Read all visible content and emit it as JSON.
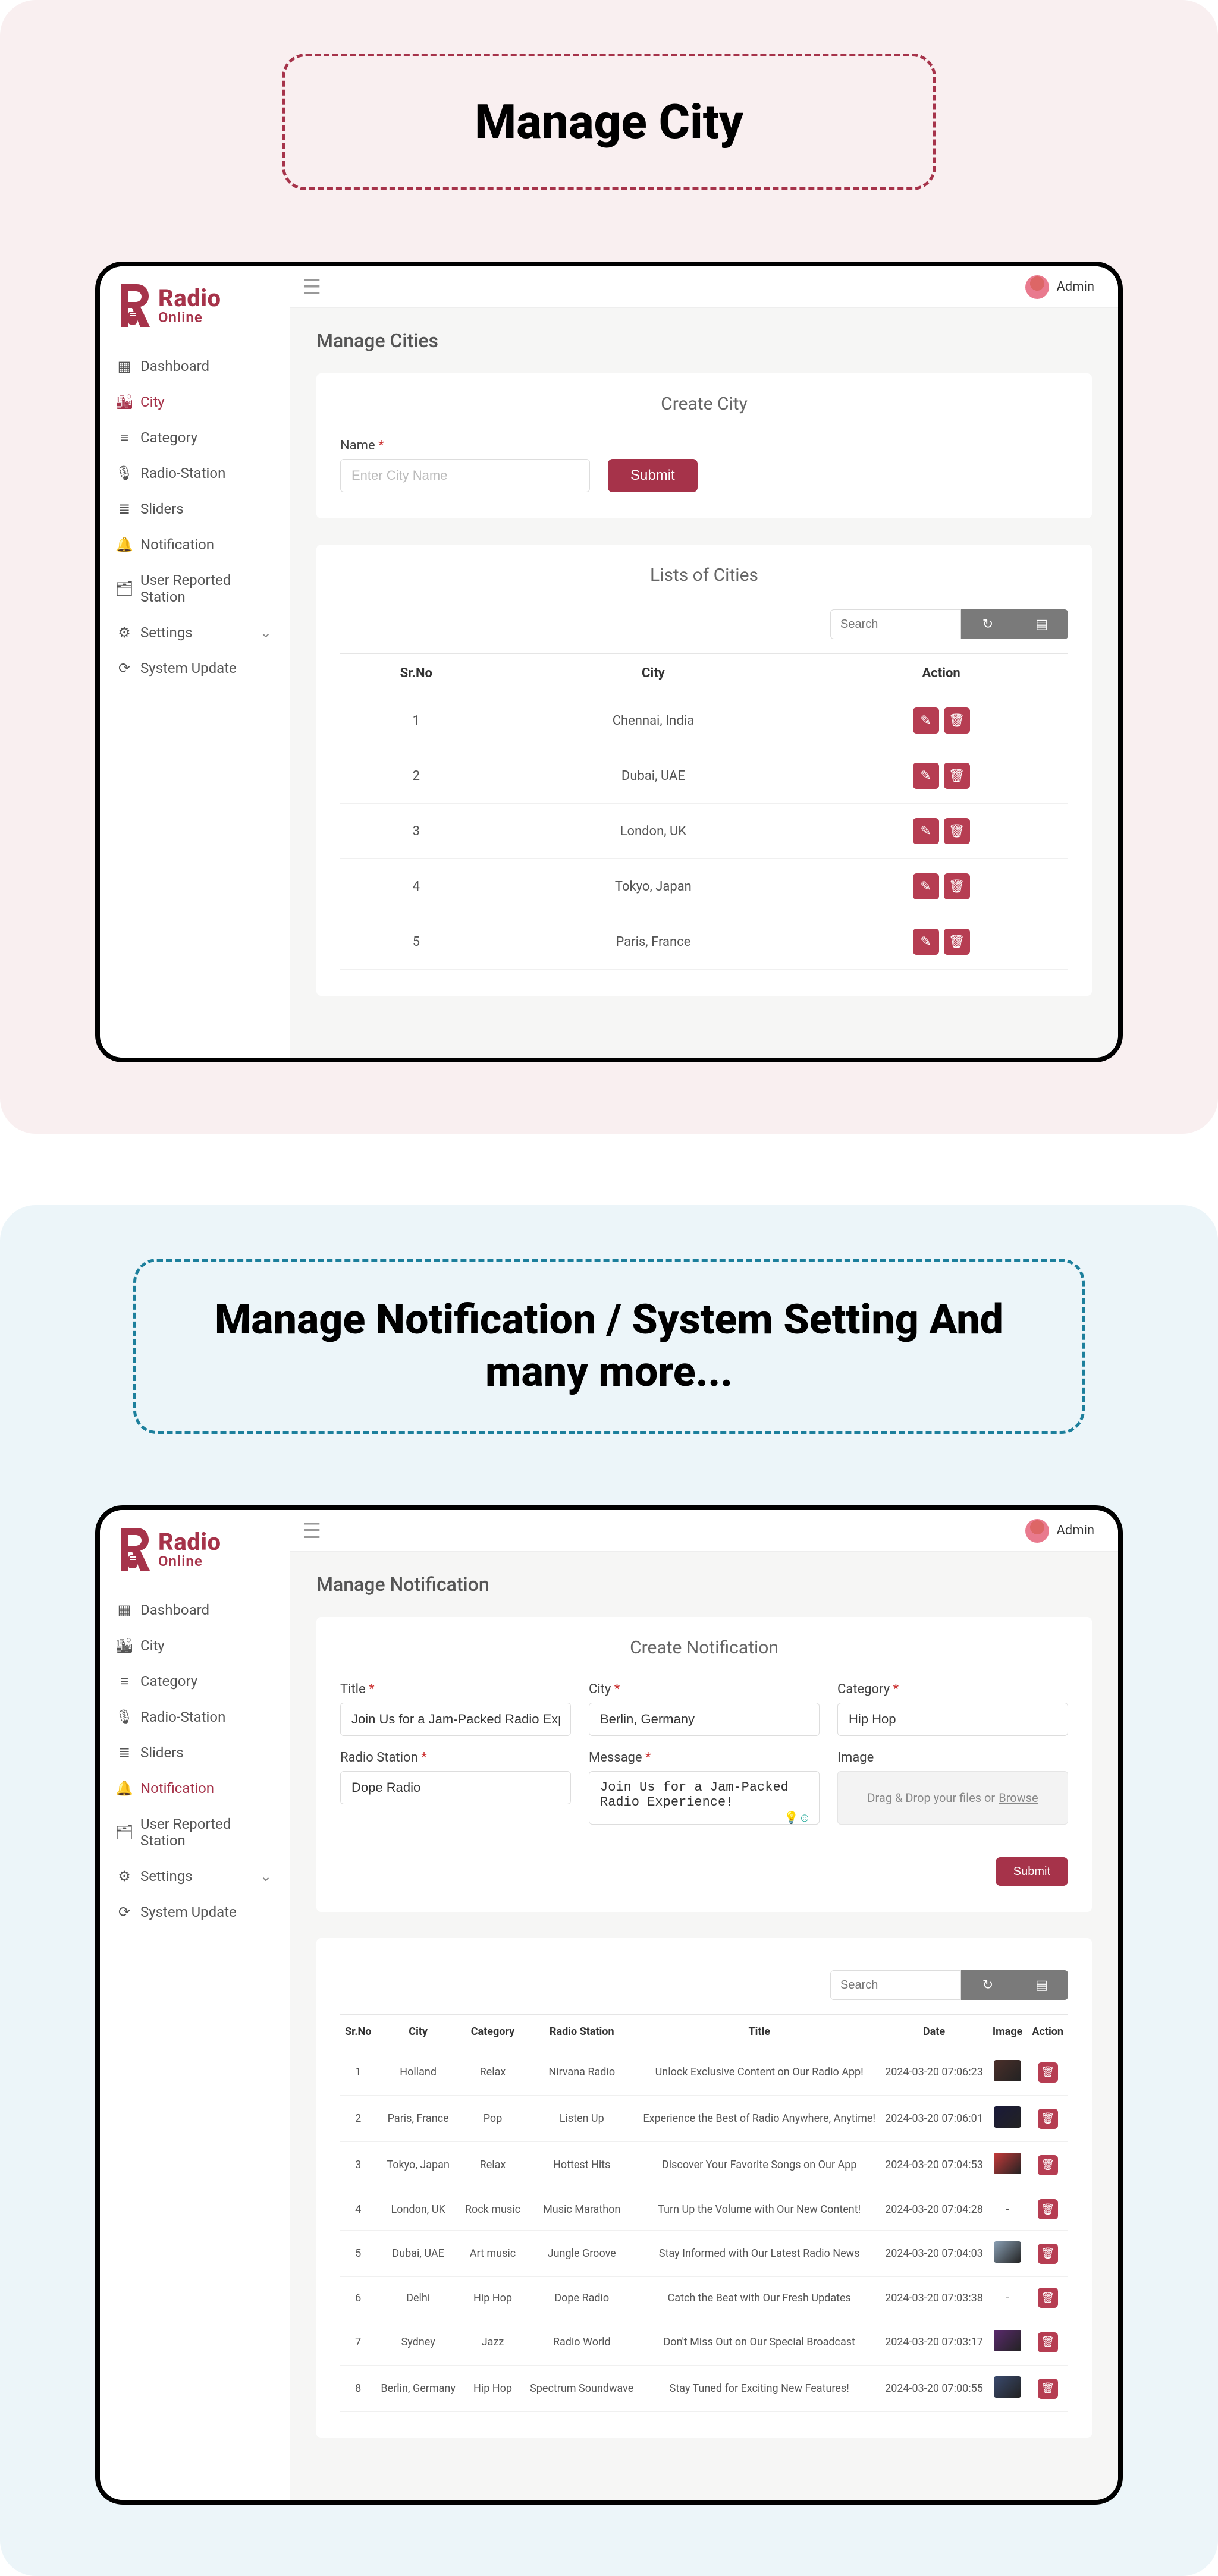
{
  "brand": {
    "name": "Radio",
    "tagline": "Online"
  },
  "user": {
    "name": "Admin"
  },
  "sidebar": {
    "items": [
      {
        "key": "dashboard",
        "label": "Dashboard",
        "icon": "grid"
      },
      {
        "key": "city",
        "label": "City",
        "icon": "building"
      },
      {
        "key": "category",
        "label": "Category",
        "icon": "list"
      },
      {
        "key": "radio-station",
        "label": "Radio-Station",
        "icon": "mic"
      },
      {
        "key": "sliders",
        "label": "Sliders",
        "icon": "sliders"
      },
      {
        "key": "notification",
        "label": "Notification",
        "icon": "bell"
      },
      {
        "key": "user-reported",
        "label": "User Reported Station",
        "icon": "report"
      },
      {
        "key": "settings",
        "label": "Settings",
        "icon": "gear",
        "expandable": true
      },
      {
        "key": "system-update",
        "label": "System Update",
        "icon": "update"
      }
    ]
  },
  "promo1": {
    "heading": "Manage City"
  },
  "promo2": {
    "heading": "Manage Notification / System Setting And many more..."
  },
  "screen1": {
    "title": "Manage Cities",
    "create": {
      "heading": "Create City",
      "name_label": "Name",
      "name_placeholder": "Enter City Name",
      "submit": "Submit"
    },
    "list": {
      "heading": "Lists of Cities",
      "search_placeholder": "Search",
      "columns": [
        "Sr.No",
        "City",
        "Action"
      ],
      "rows": [
        {
          "no": "1",
          "city": "Chennai, India"
        },
        {
          "no": "2",
          "city": "Dubai, UAE"
        },
        {
          "no": "3",
          "city": "London, UK"
        },
        {
          "no": "4",
          "city": "Tokyo, Japan"
        },
        {
          "no": "5",
          "city": "Paris, France"
        }
      ]
    }
  },
  "screen2": {
    "title": "Manage Notification",
    "create": {
      "heading": "Create Notification",
      "title_label": "Title",
      "title_value": "Join Us for a Jam-Packed Radio Experience!",
      "city_label": "City",
      "city_value": "Berlin, Germany",
      "category_label": "Category",
      "category_value": "Hip Hop",
      "station_label": "Radio Station",
      "station_value": "Dope Radio",
      "message_label": "Message",
      "message_value": "Join Us for a Jam-Packed Radio Experience!",
      "image_label": "Image",
      "dropzone_text": "Drag & Drop your files or",
      "dropzone_link": "Browse",
      "submit": "Submit"
    },
    "list": {
      "search_placeholder": "Search",
      "columns": [
        "Sr.No",
        "City",
        "Category",
        "Radio Station",
        "Title",
        "Date",
        "Image",
        "Action"
      ],
      "rows": [
        {
          "no": "1",
          "city": "Holland",
          "category": "Relax",
          "station": "Nirvana Radio",
          "title": "Unlock Exclusive Content on Our Radio App!",
          "date": "2024-03-20 07:06:23",
          "thumb": "#4b2f2a"
        },
        {
          "no": "2",
          "city": "Paris, France",
          "category": "Pop",
          "station": "Listen Up",
          "title": "Experience the Best of Radio Anywhere, Anytime!",
          "date": "2024-03-20 07:06:01",
          "thumb": "#1a1a3a"
        },
        {
          "no": "3",
          "city": "Tokyo, Japan",
          "category": "Relax",
          "station": "Hottest Hits",
          "title": "Discover Your Favorite Songs on Our App",
          "date": "2024-03-20 07:04:53",
          "thumb": "#c73a3a"
        },
        {
          "no": "4",
          "city": "London, UK",
          "category": "Rock music",
          "station": "Music Marathon",
          "title": "Turn Up the Volume with Our New Content!",
          "date": "2024-03-20 07:04:28",
          "thumb": ""
        },
        {
          "no": "5",
          "city": "Dubai, UAE",
          "category": "Art music",
          "station": "Jungle Groove",
          "title": "Stay Informed with Our Latest Radio News",
          "date": "2024-03-20 07:04:03",
          "thumb": "#8aa0b5"
        },
        {
          "no": "6",
          "city": "Delhi",
          "category": "Hip Hop",
          "station": "Dope Radio",
          "title": "Catch the Beat with Our Fresh Updates",
          "date": "2024-03-20 07:03:38",
          "thumb": ""
        },
        {
          "no": "7",
          "city": "Sydney",
          "category": "Jazz",
          "station": "Radio World",
          "title": "Don't Miss Out on Our Special Broadcast",
          "date": "2024-03-20 07:03:17",
          "thumb": "#5b2a6e"
        },
        {
          "no": "8",
          "city": "Berlin, Germany",
          "category": "Hip Hop",
          "station": "Spectrum Soundwave",
          "title": "Stay Tuned for Exciting New Features!",
          "date": "2024-03-20 07:00:55",
          "thumb": "#3a4a6e"
        }
      ]
    }
  }
}
